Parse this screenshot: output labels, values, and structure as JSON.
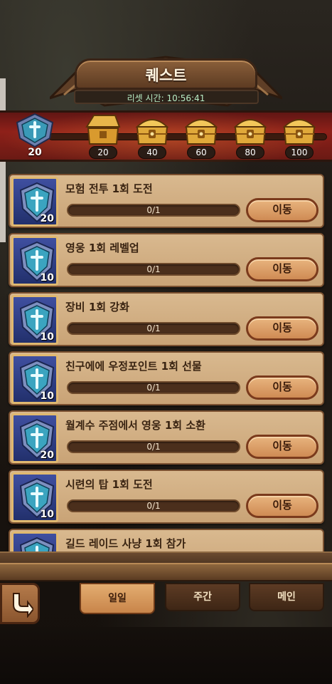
{
  "header": {
    "title": "퀘스트",
    "reset_label": "리셋 시간: 10:56:41"
  },
  "rewards": {
    "current_points": "20",
    "milestones": [
      "20",
      "40",
      "60",
      "80",
      "100"
    ]
  },
  "quests": [
    {
      "title": "모험 전투 1회 도전",
      "progress": "0/1",
      "points": "20",
      "button": "이동"
    },
    {
      "title": "영웅 1회 레벨업",
      "progress": "0/1",
      "points": "10",
      "button": "이동"
    },
    {
      "title": "장비 1회 강화",
      "progress": "0/1",
      "points": "10",
      "button": "이동"
    },
    {
      "title": "친구에에 우정포인트 1회 선물",
      "progress": "0/1",
      "points": "10",
      "button": "이동"
    },
    {
      "title": "월계수 주점에서 영웅 1회 소환",
      "progress": "0/1",
      "points": "20",
      "button": "이동"
    },
    {
      "title": "시련의 탑 1회 도전",
      "progress": "0/1",
      "points": "10",
      "button": "이동"
    },
    {
      "title": "길드 레이드 사냥 1회 참가",
      "progress": "",
      "points": "",
      "button": ""
    }
  ],
  "tabs": [
    {
      "label": "일일",
      "active": true
    },
    {
      "label": "주간",
      "active": false
    },
    {
      "label": "메인",
      "active": false
    }
  ],
  "colors": {
    "card": "#d9b98f",
    "reward_bar": "#8e2019",
    "reset_text": "#b8ecc5",
    "shield_blue": "#3f4fa0"
  },
  "icons": [
    "shield-icon",
    "chest-icon",
    "back-arrow-icon"
  ]
}
